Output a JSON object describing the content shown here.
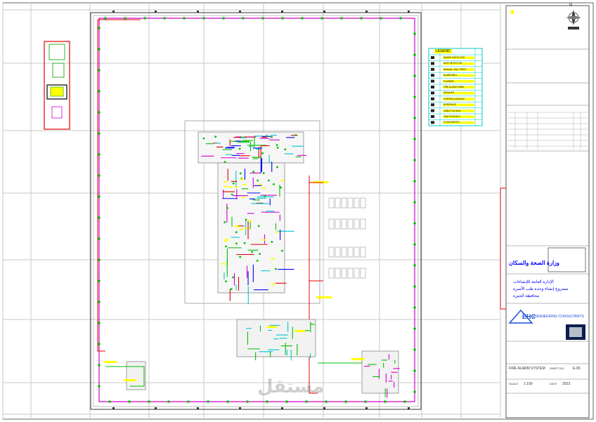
{
  "sheet": {
    "ministry_name": "وزارة الصحة والسكان",
    "project_lines": [
      "الإدارة العامة للإنشاءات",
      "مشروع إنشاء وحدة طب الأسرة",
      "محافظة الجيزة"
    ],
    "consultant_name": "ENGINEERING CONSULTANTS",
    "consultant_logo": "EHC",
    "watermark": "مستقل",
    "north_label": "N",
    "drawing_title": "FIRE ALARM SYSTEM",
    "sheet_no_label": "SHEET NO.",
    "sheet_no": "E-05",
    "scale_label": "SCALE",
    "scale": "1:100",
    "date_label": "DATE",
    "date": "2023"
  },
  "legend": {
    "header": "LEGEND",
    "rows": [
      {
        "symbol": "smoke-detector",
        "label": "SMOKE DETECTOR"
      },
      {
        "symbol": "heat-detector",
        "label": "HEAT DETECTOR"
      },
      {
        "symbol": "manual-call-point",
        "label": "MANUAL CALL POINT"
      },
      {
        "symbol": "bell",
        "label": "ALARM BELL"
      },
      {
        "symbol": "strobe",
        "label": "FLASHER"
      },
      {
        "symbol": "panel",
        "label": "FIRE ALARM PANEL"
      },
      {
        "symbol": "speaker",
        "label": "SPEAKER"
      },
      {
        "symbol": "module",
        "label": "CONTROL MODULE"
      },
      {
        "symbol": "interface",
        "label": "INTERFACE"
      },
      {
        "symbol": "cable",
        "label": "CABLE 2x1.5mm"
      },
      {
        "symbol": "junction",
        "label": "JUNCTION BOX"
      },
      {
        "symbol": "valve",
        "label": "FLOW SWITCH"
      }
    ]
  },
  "colors": {
    "frame": "#555555",
    "grid": "#c8c8c8",
    "red": "#e00000",
    "magenta": "#d000d0",
    "green": "#00c000",
    "cyan": "#00c8d0",
    "yellow": "#ffff00",
    "blue": "#0000ff"
  }
}
